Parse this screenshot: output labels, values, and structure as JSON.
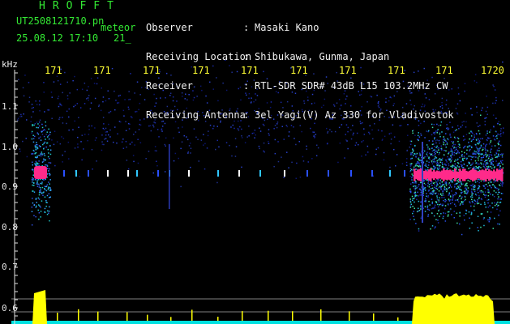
{
  "header": {
    "title": "HROFFT",
    "file": "UT2508121710.pn",
    "kind": "meteor",
    "date": "25.08.12 17:10",
    "seconds": "21_"
  },
  "info": [
    {
      "label": "Observer",
      "sep": ":",
      "value": "Masaki Kano"
    },
    {
      "label": "Receiving Location",
      "sep": ":",
      "value": "Shibukawa, Gunma, Japan"
    },
    {
      "label": "Receiver",
      "sep": ":",
      "value": "RTL-SDR SDR# 43dB L15 103.2MHz CW"
    },
    {
      "label": "Receiving Antenna",
      "sep": ":",
      "value": "3el Yagi(V) Az 330 for Vladivostok"
    }
  ],
  "axis": {
    "unit": "kHz",
    "y_labels": [
      "1.1",
      "1.0",
      "0.9",
      "0.8",
      "0.7",
      "0.6"
    ],
    "x_labels": [
      "171",
      "171",
      "171",
      "171",
      "171",
      "171",
      "171",
      "171",
      "171",
      "1720"
    ]
  },
  "colors": {
    "header_text": "#33e833",
    "label_text": "#f0f0f0",
    "time_labels": "#ffff33",
    "echo_core": "#ff2a8a",
    "noise": "#1a2aa8",
    "amplitude": "#ffff00",
    "baseline": "#00e0e0"
  }
}
